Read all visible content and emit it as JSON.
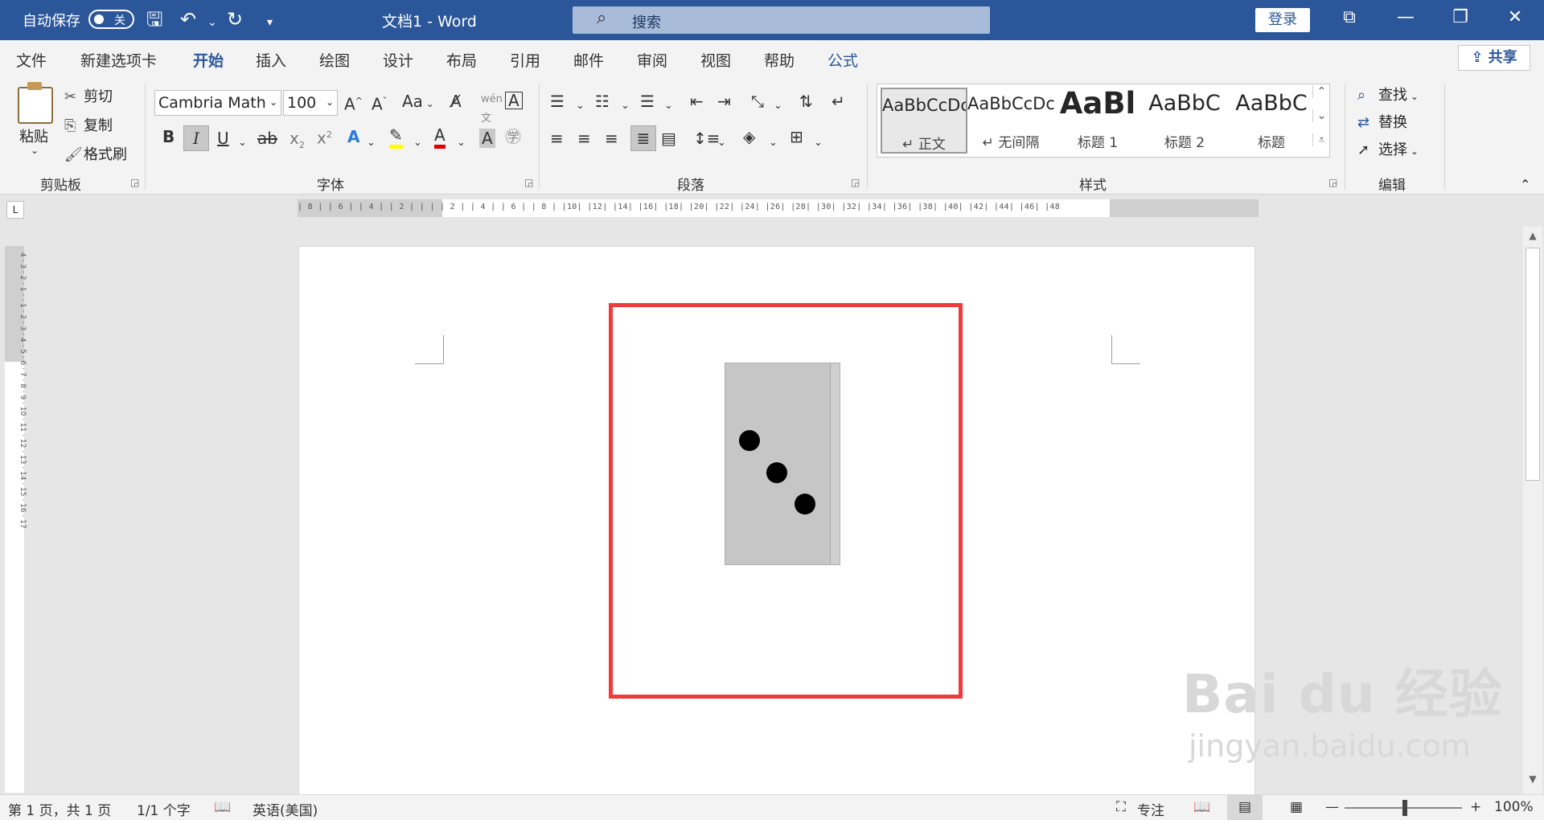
{
  "titlebar": {
    "autosave_label": "自动保存",
    "autosave_state": "关",
    "doc_title": "文档1  -  Word",
    "search_placeholder": "搜索",
    "login_label": "登录"
  },
  "tabs": [
    "文件",
    "新建选项卡",
    "开始",
    "插入",
    "绘图",
    "设计",
    "布局",
    "引用",
    "邮件",
    "审阅",
    "视图",
    "帮助",
    "公式"
  ],
  "active_tab": "开始",
  "share_label": "共享",
  "clipboard": {
    "paste": "粘贴",
    "cut": "剪切",
    "copy": "复制",
    "format_painter": "格式刷",
    "group_label": "剪贴板"
  },
  "font": {
    "family": "Cambria Math",
    "size": "100",
    "group_label": "字体",
    "change_case": "Aa"
  },
  "paragraph": {
    "group_label": "段落"
  },
  "styles": {
    "group_label": "样式",
    "items": [
      {
        "sample": "AaBbCcDc",
        "name": "↵ 正文"
      },
      {
        "sample": "AaBbCcDc",
        "name": "↵ 无间隔"
      },
      {
        "sample": "AaBl",
        "name": "标题 1"
      },
      {
        "sample": "AaBbC",
        "name": "标题 2"
      },
      {
        "sample": "AaBbC",
        "name": "标题"
      }
    ]
  },
  "editing": {
    "find": "查找",
    "replace": "替换",
    "select": "选择",
    "group_label": "编辑"
  },
  "ruler": {
    "ticks": "| 8 |   | 6 |   | 4 |   | 2 |   |   |   | 2 |   | 4 |   | 6 |   | 8 |   |10|   |12|   |14|   |16|   |18|   |20|   |22|   |24|   |26|   |28|   |30|   |32|   |34|   |36|   |38|   |40|   |42|   |44|   |46|   |48",
    "vticks": "4 · 3 · 2 · 1 · · 1 · 2 · 3 · 4 · 5 · 6 · 7 · 8 · 9 · 10 · 11 · 12 · 13 · 14 · 15 · 16 · 17"
  },
  "status": {
    "page": "第 1 页，共 1 页",
    "words": "1/1 个字",
    "language": "英语(美国)",
    "focus": "专注",
    "zoom": "100%"
  },
  "watermark": {
    "brand": "Bai du 经验",
    "url": "jingyan.baidu.com"
  },
  "colors": {
    "title_bar": "#2b579a",
    "highlight_box": "#ef3b3b",
    "domino_face": "#c6c6c6"
  }
}
